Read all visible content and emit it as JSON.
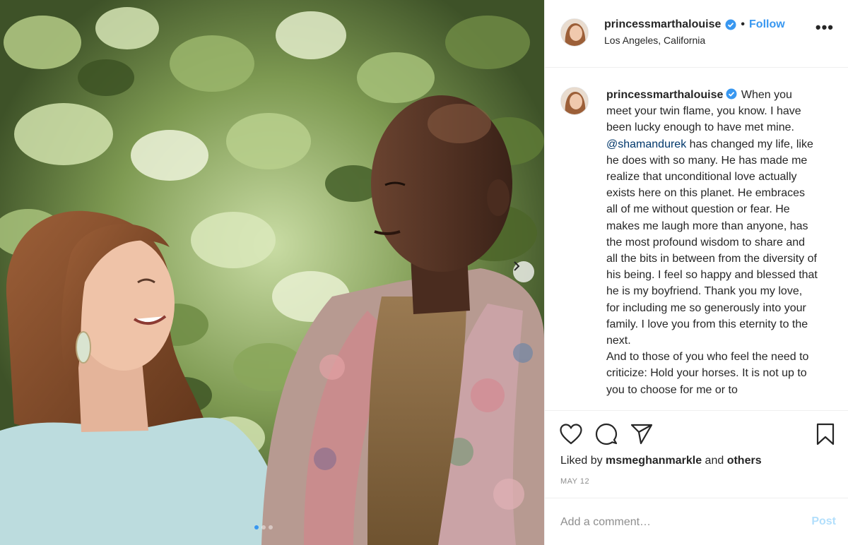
{
  "post": {
    "username": "princessmarthalouise",
    "follow_label": "Follow",
    "bullet": "•",
    "location": "Los Angeles, California",
    "more_label": "•••",
    "caption": {
      "username": "princessmarthalouise",
      "part1": " When you meet your twin flame, you know. I have been lucky enough to have met mine. ",
      "mention": "@shamandurek",
      "part2": " has changed my life, like he does with so many. He has made me realize that unconditional love actually exists here on this planet. He embraces all of me without question or fear. He makes me laugh more than anyone, has the most profound wisdom to share and all the bits in between from the diversity of his being. I feel so happy and blessed that he is my boyfriend. Thank you my love, for including me so generously into your family. I love you from this eternity to the next.",
      "part3": "And to those of you who feel the need to criticize: Hold your horses. It is not up to you to choose for me or to"
    },
    "likes_prefix": "Liked by ",
    "likes_user": "msmeghanmarkle",
    "likes_middle": " and ",
    "likes_others": "others",
    "date": "MAY 12",
    "comment_placeholder": "Add a comment…",
    "post_label": "Post"
  },
  "colors": {
    "link_blue": "#3897f0",
    "mention": "#00376b",
    "muted": "#8e8e8e",
    "post_disabled": "#b2dffc"
  },
  "icons": [
    "verified-badge-icon",
    "more-options-icon",
    "heart-icon",
    "comment-icon",
    "share-icon",
    "bookmark-icon",
    "carousel-next-icon"
  ]
}
